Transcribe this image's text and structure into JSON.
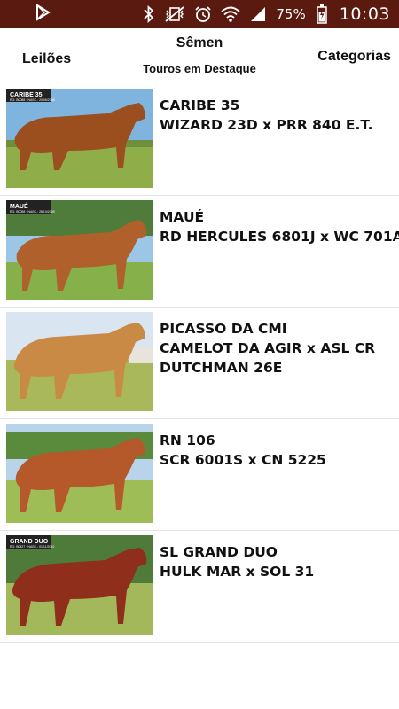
{
  "status_bar": {
    "battery_percent": "75%",
    "time": "10:03",
    "icons": [
      "play-store-icon",
      "bluetooth-icon",
      "vibrate-mute-icon",
      "alarm-icon",
      "wifi-icon",
      "signal-icon",
      "battery-icon"
    ]
  },
  "header": {
    "left_tab": "Leilões",
    "center_tab": "Sêmen",
    "center_subtitle": "Touros em Destaque",
    "right_tab": "Categorias"
  },
  "bulls": [
    {
      "name": "CARIBE 35",
      "pedigree_lines": [
        "WIZARD 23D x PRR 840 E.T."
      ],
      "photo_caption": "CARIBE 35",
      "photo_caption_sub": "RG: B0088 · NASC.: 20/06/2008"
    },
    {
      "name": "MAUÉ",
      "pedigree_lines": [
        "RD HERCULES 6801J x WC 701A"
      ],
      "photo_caption": "MAUÉ",
      "photo_caption_sub": "RG: B0058 · NASC.: 28/10/2009"
    },
    {
      "name": "PICASSO DA CMI",
      "pedigree_lines": [
        "CAMELOT DA AGIR x ASL CR",
        "DUTCHMAN 26E"
      ],
      "photo_caption": "",
      "photo_caption_sub": ""
    },
    {
      "name": "RN 106",
      "pedigree_lines": [
        "SCR 6001S x CN 5225"
      ],
      "photo_caption": "",
      "photo_caption_sub": ""
    },
    {
      "name": "SL GRAND DUO",
      "pedigree_lines": [
        "HULK MAR x SOL 31"
      ],
      "photo_caption": "GRAND DUO",
      "photo_caption_sub": "RG: B0427 · NASC.: 01/11/2010"
    }
  ],
  "colors": {
    "status_bar_bg": "#5a1a10",
    "background": "#ffffff",
    "divider": "#e4e4e4"
  }
}
